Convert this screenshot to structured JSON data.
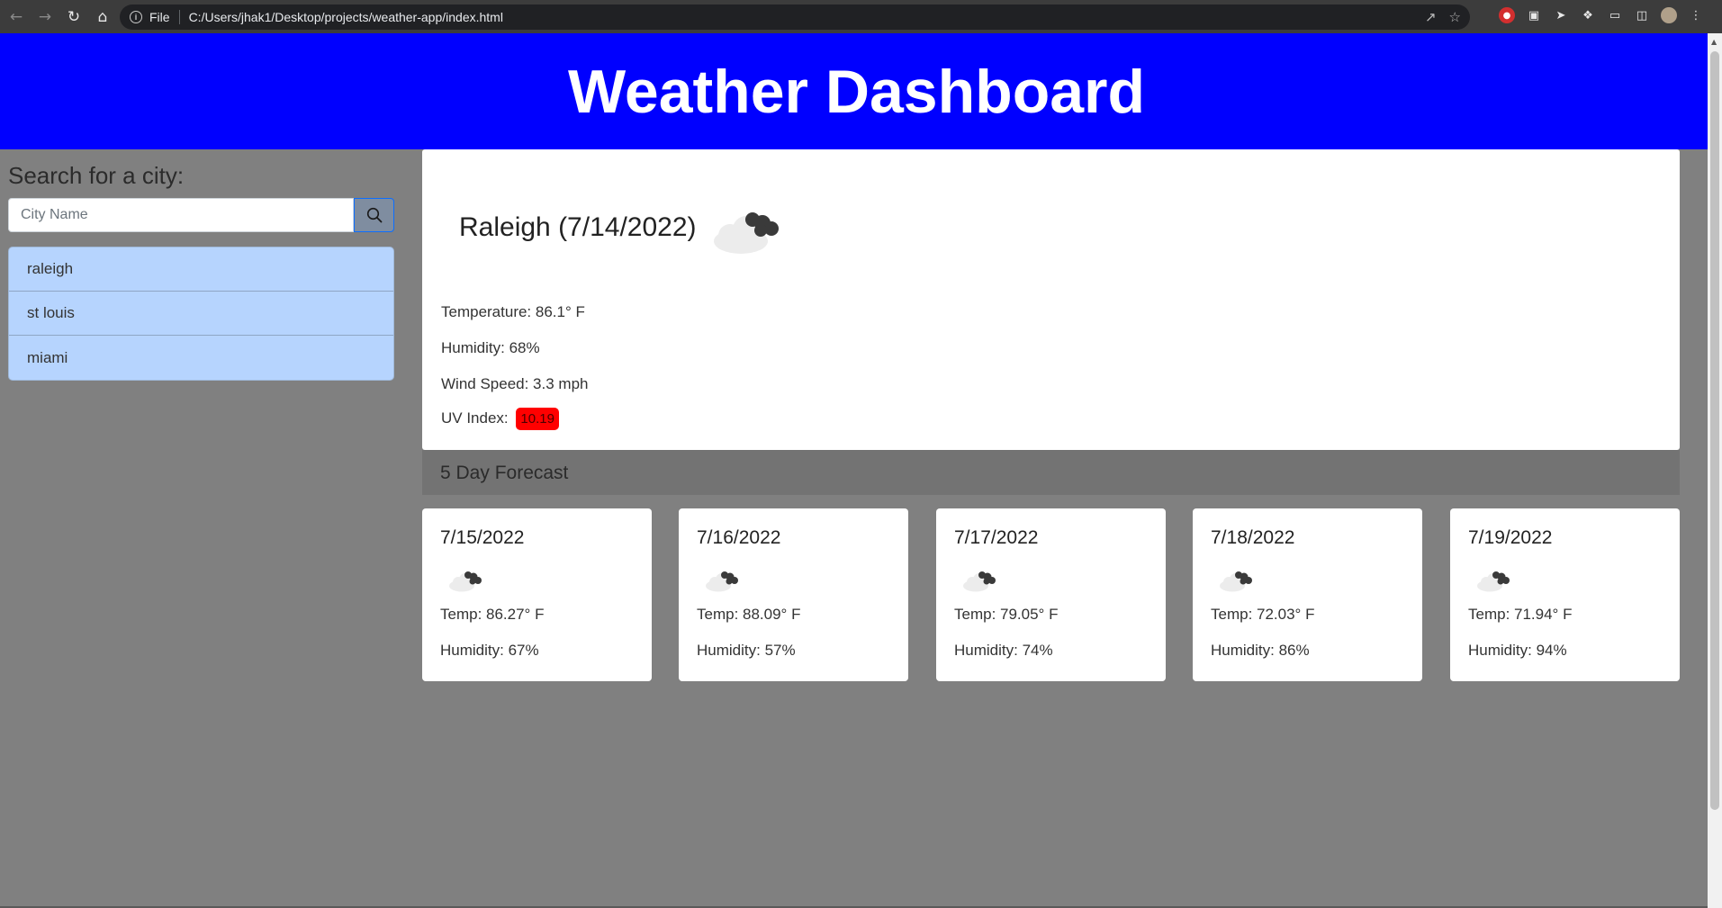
{
  "browser": {
    "file_label": "File",
    "url": "C:/Users/jhak1/Desktop/projects/weather-app/index.html"
  },
  "header": {
    "title": "Weather Dashboard"
  },
  "sidebar": {
    "search_title": "Search for a city:",
    "search_placeholder": "City Name",
    "cities": [
      "raleigh",
      "st louis",
      "miami"
    ]
  },
  "current": {
    "title": "Raleigh (7/14/2022)",
    "icon": "broken-clouds-icon",
    "temperature": "Temperature: 86.1° F",
    "humidity": "Humidity: 68%",
    "wind": "Wind Speed: 3.3 mph",
    "uv_label": "UV Index:",
    "uv_value": "10.19",
    "uv_color": "#ff0000"
  },
  "forecast": {
    "title": "5 Day Forecast",
    "days": [
      {
        "date": "7/15/2022",
        "icon": "broken-clouds-icon",
        "temp": "Temp: 86.27° F",
        "humidity": "Humidity: 67%"
      },
      {
        "date": "7/16/2022",
        "icon": "broken-clouds-icon",
        "temp": "Temp: 88.09° F",
        "humidity": "Humidity: 57%"
      },
      {
        "date": "7/17/2022",
        "icon": "broken-clouds-icon",
        "temp": "Temp: 79.05° F",
        "humidity": "Humidity: 74%"
      },
      {
        "date": "7/18/2022",
        "icon": "broken-clouds-icon",
        "temp": "Temp: 72.03° F",
        "humidity": "Humidity: 86%"
      },
      {
        "date": "7/19/2022",
        "icon": "broken-clouds-icon",
        "temp": "Temp: 71.94° F",
        "humidity": "Humidity: 94%"
      }
    ]
  },
  "colors": {
    "header_bg": "#0000ff",
    "page_bg": "#808080",
    "list_bg": "#b6d4fe"
  }
}
